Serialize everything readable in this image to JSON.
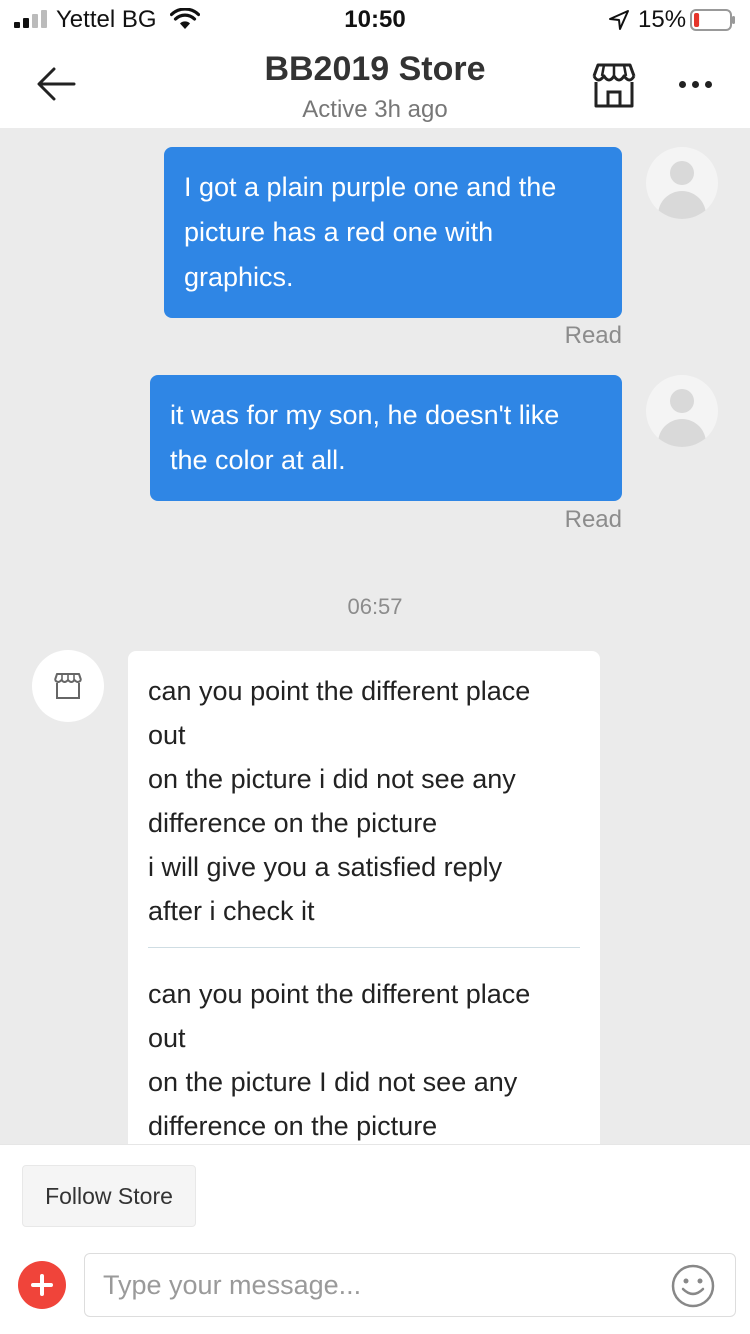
{
  "status_bar": {
    "carrier": "Yettel BG",
    "time": "10:50",
    "battery_percent": "15%",
    "battery_level": 0.15,
    "battery_color": "#e6352b"
  },
  "header": {
    "title": "BB2019 Store",
    "subtitle": "Active 3h ago",
    "icons": [
      "back-arrow-icon",
      "store-icon",
      "more-icon"
    ]
  },
  "messages": [
    {
      "direction": "outgoing",
      "text": "I got a plain purple one and the picture has a red one with graphics.",
      "status": "Read"
    },
    {
      "direction": "outgoing",
      "text": "it was for my son, he doesn't like the color at all.",
      "status": "Read"
    },
    {
      "type": "timestamp",
      "text": "06:57"
    },
    {
      "direction": "incoming",
      "parts": [
        "can you point the different place\nout\non the picture i did not see any\ndifference on the picture\ni will give  you a satisfied reply\nafter  i check  it",
        "can you point the different place\nout\non the picture I did not see any\ndifference on the picture"
      ]
    }
  ],
  "footer": {
    "follow_label": "Follow Store",
    "input_placeholder": "Type your message...",
    "input_value": "",
    "plus_color": "#f0443a",
    "icons": [
      "plus-icon",
      "emoji-icon"
    ]
  },
  "colors": {
    "accent": "#2f86e5",
    "background": "#ebebeb"
  }
}
